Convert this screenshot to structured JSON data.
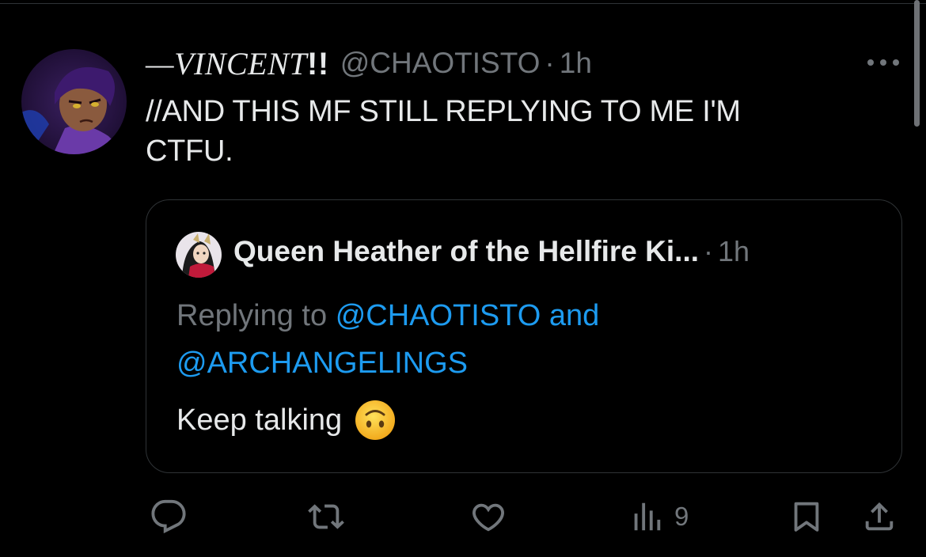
{
  "tweet": {
    "display_name": "—VINCENT",
    "display_name_suffix": "!!",
    "handle": "@CHAOTISTO",
    "separator": "·",
    "time": "1h",
    "more_icon": "more-horizontal-icon",
    "text_line1": "//AND THIS MF STILL REPLYING TO ME I'M",
    "text_line2": "CTFU."
  },
  "quote": {
    "name": "Queen Heather of the Hellfire Ki...",
    "separator": "·",
    "time": "1h",
    "replying_prefix": "Replying to",
    "mention1": "@CHAOTISTO",
    "conjunction": "and",
    "mention2": "@ARCHANGELINGS",
    "text": "Keep talking",
    "emoji": "upside-down-face-emoji"
  },
  "actions": {
    "reply_icon": "reply-icon",
    "retweet_icon": "retweet-icon",
    "like_icon": "like-icon",
    "views_icon": "views-icon",
    "views_count": "9",
    "bookmark_icon": "bookmark-icon",
    "share_icon": "share-icon"
  },
  "colors": {
    "background": "#000000",
    "text": "#e7e9ea",
    "secondary": "#71767b",
    "accent": "#1d9bf0",
    "border": "#2f3336"
  }
}
